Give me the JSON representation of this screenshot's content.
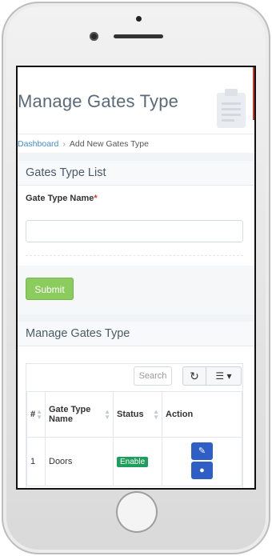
{
  "page": {
    "title": "Manage Gates Type",
    "breadcrumb": {
      "home": "Dashboard",
      "current": "Add New Gates Type"
    }
  },
  "form_card": {
    "heading": "Gates Type List",
    "field_label": "Gate Type Name",
    "required_mark": "*",
    "field_value": "",
    "submit_label": "Submit"
  },
  "list_card": {
    "heading": "Manage Gates Type",
    "search_placeholder": "Search",
    "columns": [
      "#",
      "Gate Type Name",
      "Status",
      "Action"
    ],
    "rows": [
      {
        "index": "1",
        "name": "Doors",
        "status": "Enable"
      }
    ]
  },
  "icons": {
    "refresh": "refresh-icon",
    "columns": "columns-list-icon",
    "edit": "pencil-icon",
    "clipboard": "clipboard-icon"
  },
  "colors": {
    "link": "#3f8fd0",
    "submit": "#8ccc5f",
    "badge_enable": "#1e9e5a",
    "action_button": "#2f5ec4",
    "required": "#e3342f"
  }
}
